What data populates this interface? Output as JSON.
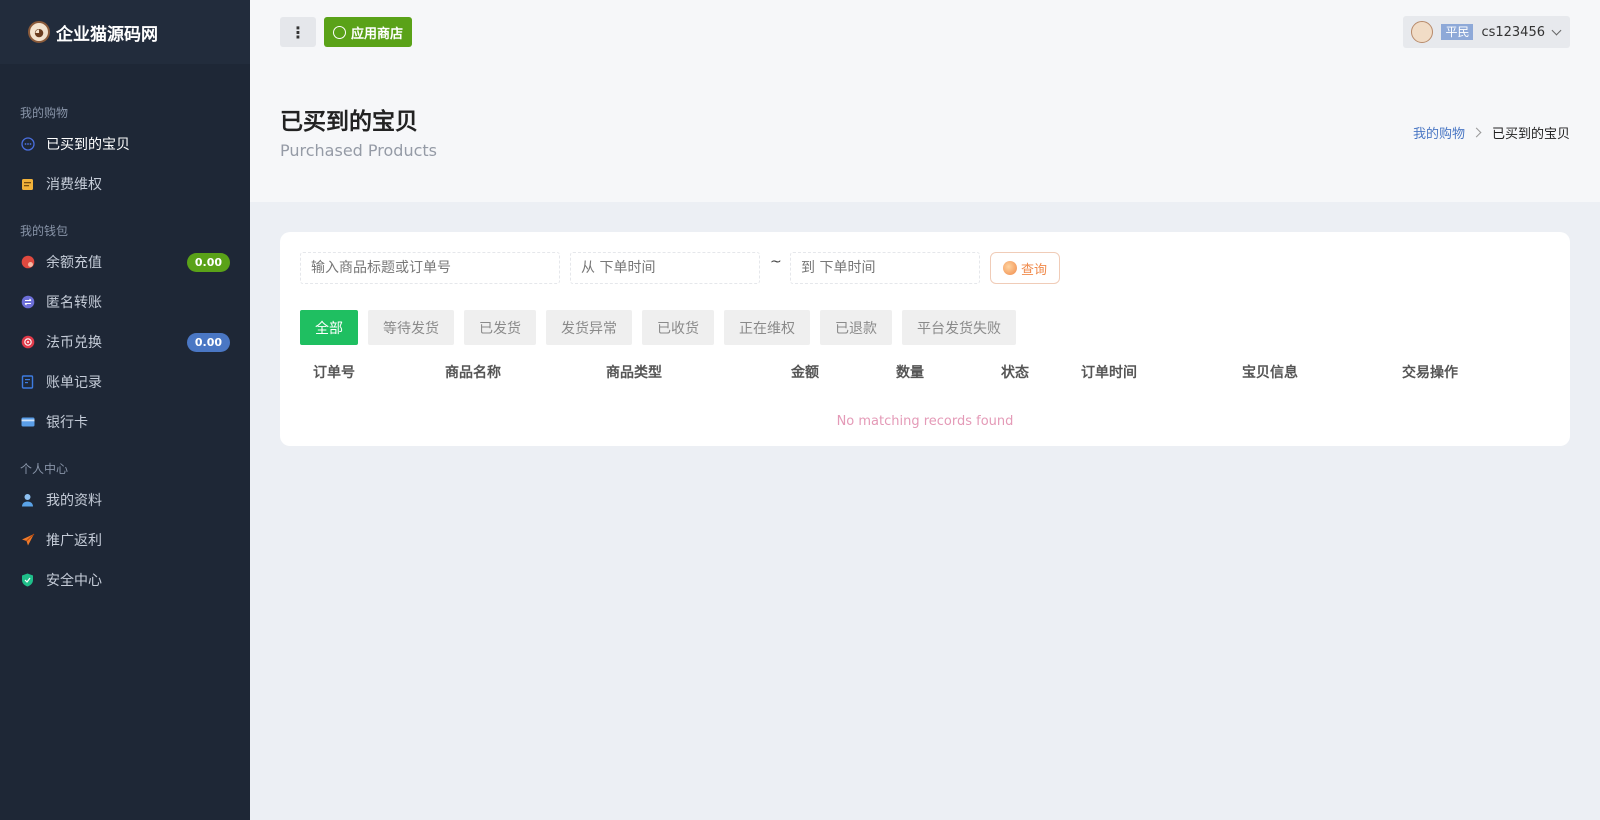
{
  "brand": {
    "name": "企业猫源码网",
    "logo_icon": "cat-logo-icon"
  },
  "sidebar": {
    "groups": [
      {
        "title": "我的购物",
        "items": [
          {
            "label": "已买到的宝贝",
            "icon": "circle-dots-icon",
            "active": true
          },
          {
            "label": "消费维权",
            "icon": "notepad-icon"
          }
        ]
      },
      {
        "title": "我的钱包",
        "items": [
          {
            "label": "余额充值",
            "icon": "recharge-icon",
            "badge": "0.00",
            "badge_color": "#5aa218"
          },
          {
            "label": "匿名转账",
            "icon": "transfer-icon"
          },
          {
            "label": "法币兑换",
            "icon": "exchange-icon",
            "badge": "0.00",
            "badge_color": "#4a77c4"
          },
          {
            "label": "账单记录",
            "icon": "bill-icon"
          },
          {
            "label": "银行卡",
            "icon": "bank-card-icon"
          }
        ]
      },
      {
        "title": "个人中心",
        "items": [
          {
            "label": "我的资料",
            "icon": "user-icon"
          },
          {
            "label": "推广返利",
            "icon": "paper-plane-icon"
          },
          {
            "label": "安全中心",
            "icon": "shield-icon"
          }
        ]
      }
    ]
  },
  "topbar": {
    "menu_icon": "more-vertical-icon",
    "store_label": "应用商店",
    "user": {
      "role": "平民",
      "name": "cs123456"
    }
  },
  "header": {
    "title": "已买到的宝贝",
    "subtitle": "Purchased Products",
    "breadcrumb": {
      "parent": "我的购物",
      "current": "已买到的宝贝"
    }
  },
  "filters": {
    "keyword_placeholder": "输入商品标题或订单号",
    "from_placeholder": "从 下单时间",
    "separator": "~",
    "to_placeholder": "到 下单时间",
    "query_label": "查询"
  },
  "tabs": [
    "全部",
    "等待发货",
    "已发货",
    "发货异常",
    "已收货",
    "正在维权",
    "已退款",
    "平台发货失败"
  ],
  "table": {
    "columns": [
      "订单号",
      "商品名称",
      "商品类型",
      "金额",
      "数量",
      "状态",
      "订单时间",
      "宝贝信息",
      "交易操作"
    ],
    "empty_text": "No matching records found"
  },
  "colors": {
    "sidebar_bg": "#1e2736",
    "accent_green": "#1fbf61",
    "store_green": "#5aa218",
    "link_blue": "#4a77c4",
    "empty_pink": "#e49ab7"
  }
}
